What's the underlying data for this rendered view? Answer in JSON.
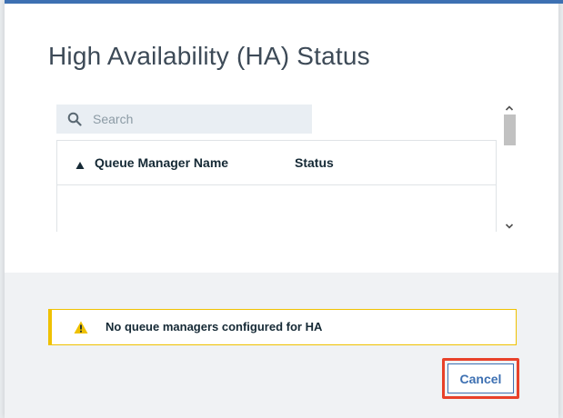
{
  "dialog": {
    "title": "High Availability (HA) Status"
  },
  "search": {
    "placeholder": "Search",
    "value": ""
  },
  "table": {
    "columns": [
      "Queue Manager Name",
      "Status"
    ],
    "sort_column": "Queue Manager Name",
    "sort_direction": "ascending",
    "rows": []
  },
  "notification": {
    "type": "warning",
    "message": "No queue managers configured for HA"
  },
  "actions": {
    "cancel_label": "Cancel"
  },
  "colors": {
    "accent": "#3d70b2",
    "warning": "#efc100",
    "highlight": "#e8412a",
    "title_text": "#3d4a57"
  },
  "icons": {
    "search": "search-icon",
    "sort": "sort-ascending-icon",
    "warning": "warning-triangle-icon",
    "scroll_up": "chevron-up-icon",
    "scroll_down": "chevron-down-icon"
  }
}
